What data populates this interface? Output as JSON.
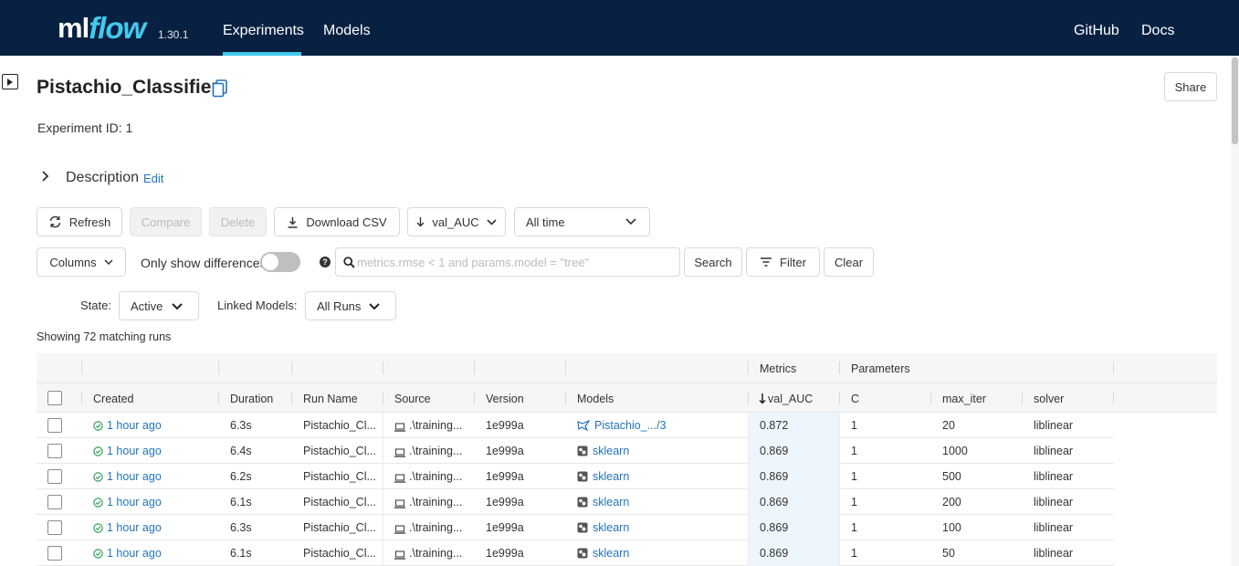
{
  "app": {
    "logo_ml": "ml",
    "logo_flow": "flow",
    "version": "1.30.1",
    "nav": [
      "Experiments",
      "Models"
    ],
    "nav_right": [
      "GitHub",
      "Docs"
    ],
    "accent_color": "#43C9ED",
    "header_color": "#082142"
  },
  "experiment": {
    "title": "Pistachio_Classifier",
    "id_label": "Experiment ID:",
    "id_value": "1",
    "share_label": "Share",
    "description_label": "Description",
    "description_edit": "Edit"
  },
  "toolbar": {
    "refresh": "Refresh",
    "compare": "Compare",
    "delete": "Delete",
    "download_csv": "Download CSV",
    "sort_by": "val_AUC",
    "time_range": "All time",
    "columns": "Columns",
    "only_show_differences": "Only show differences",
    "only_show_differences_on": false,
    "search_placeholder": "metrics.rmse < 1 and params.model = \"tree\"",
    "search": "Search",
    "filter": "Filter",
    "clear": "Clear",
    "state_label": "State:",
    "state_value": "Active",
    "linked_models_label": "Linked Models:",
    "linked_models_value": "All Runs"
  },
  "summary": "Showing 72 matching runs",
  "table": {
    "group_headers": {
      "metrics": "Metrics",
      "parameters": "Parameters"
    },
    "columns": [
      "Created",
      "Duration",
      "Run Name",
      "Source",
      "Version",
      "Models",
      "val_AUC",
      "C",
      "max_iter",
      "solver"
    ],
    "rows": [
      {
        "created": "1 hour ago",
        "duration": "6.3s",
        "run_name": "Pistachio_Cl...",
        "source": ".\\training...",
        "version": "1e999a",
        "model": "Pistachio_.../3",
        "model_icon": "registered-model-icon",
        "val_auc": "0.872",
        "c": "1",
        "max_iter": "20",
        "solver": "liblinear"
      },
      {
        "created": "1 hour ago",
        "duration": "6.4s",
        "run_name": "Pistachio_Cl...",
        "source": ".\\training...",
        "version": "1e999a",
        "model": "sklearn",
        "model_icon": "sklearn-icon",
        "val_auc": "0.869",
        "c": "1",
        "max_iter": "1000",
        "solver": "liblinear"
      },
      {
        "created": "1 hour ago",
        "duration": "6.2s",
        "run_name": "Pistachio_Cl...",
        "source": ".\\training...",
        "version": "1e999a",
        "model": "sklearn",
        "model_icon": "sklearn-icon",
        "val_auc": "0.869",
        "c": "1",
        "max_iter": "500",
        "solver": "liblinear"
      },
      {
        "created": "1 hour ago",
        "duration": "6.1s",
        "run_name": "Pistachio_Cl...",
        "source": ".\\training...",
        "version": "1e999a",
        "model": "sklearn",
        "model_icon": "sklearn-icon",
        "val_auc": "0.869",
        "c": "1",
        "max_iter": "200",
        "solver": "liblinear"
      },
      {
        "created": "1 hour ago",
        "duration": "6.3s",
        "run_name": "Pistachio_Cl...",
        "source": ".\\training...",
        "version": "1e999a",
        "model": "sklearn",
        "model_icon": "sklearn-icon",
        "val_auc": "0.869",
        "c": "1",
        "max_iter": "100",
        "solver": "liblinear"
      },
      {
        "created": "1 hour ago",
        "duration": "6.1s",
        "run_name": "Pistachio_Cl...",
        "source": ".\\training...",
        "version": "1e999a",
        "model": "sklearn",
        "model_icon": "sklearn-icon",
        "val_auc": "0.869",
        "c": "1",
        "max_iter": "50",
        "solver": "liblinear"
      }
    ]
  }
}
